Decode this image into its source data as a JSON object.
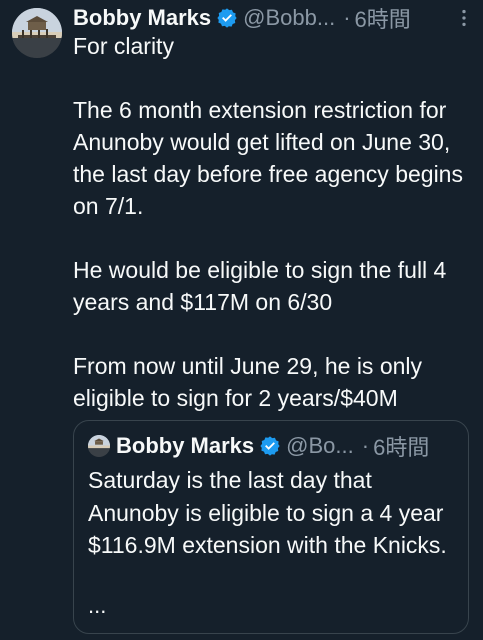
{
  "tweet": {
    "author_name": "Bobby Marks",
    "handle": "@Bobb...",
    "separator": "·",
    "time": "6時間",
    "verified_color": "#1d9bf0",
    "icons": {
      "verified": "verified-badge-icon",
      "more": "more-options-icon"
    },
    "paragraphs": [
      "For clarity",
      "The 6 month extension restriction for Anunoby would get lifted on June 30, the last day before free agency begins on 7/1.",
      "He would be eligible to sign the full 4 years and $117M on 6/30",
      "From now until June 29, he is only eligible to sign for 2 years/$40M"
    ]
  },
  "quote": {
    "author_name": "Bobby Marks",
    "handle": "@Bo...",
    "separator": "·",
    "time": "6時間",
    "text": "Saturday is the last day that Anunoby is eligible to sign a 4 year $116.9M extension with the Knicks.",
    "more": "..."
  }
}
